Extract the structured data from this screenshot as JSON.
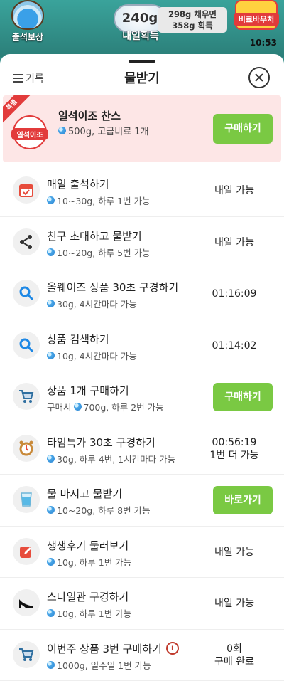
{
  "topbar": {
    "attend_label": "출석보상",
    "daily_amount": "240g",
    "daily_label": "내일획득",
    "fill_note_line1": "298g 채우면",
    "fill_note_line2": "358g 획득",
    "shop_label": "비료바우처",
    "time": "10:53"
  },
  "header": {
    "menu_label": "기록",
    "title": "물받기"
  },
  "featured": {
    "badge": "특별",
    "logo_text": "일석이조",
    "title": "일석이조 찬스",
    "reward": "500g, 고급비료 1개",
    "button": "구매하기"
  },
  "tasks": [
    {
      "title": "매일 출석하기",
      "prefix": "",
      "reward": "10~30g, 하루 1번 가능",
      "status": "내일 가능",
      "icon": "calendar-icon"
    },
    {
      "title": "친구 초대하고 물받기",
      "prefix": "",
      "reward": "10~20g, 하루 5번 가능",
      "status": "내일 가능",
      "icon": "share-icon"
    },
    {
      "title": "올웨이즈 상품 30초 구경하기",
      "prefix": "",
      "reward": "30g, 4시간마다 가능",
      "status": "01:16:09",
      "icon": "search-icon"
    },
    {
      "title": "상품 검색하기",
      "prefix": "",
      "reward": "10g, 4시간마다 가능",
      "status": "01:14:02",
      "icon": "search-icon"
    },
    {
      "title": "상품 1개 구매하기",
      "prefix": "구매시",
      "reward": "700g, 하루 2번 가능",
      "button": "구매하기",
      "icon": "cart-icon"
    },
    {
      "title": "타임특가 30초 구경하기",
      "prefix": "",
      "reward": "30g, 하루 4번, 1시간마다 가능",
      "status": "00:56:19",
      "status2": "1번 더 가능",
      "icon": "alarm-clock-icon"
    },
    {
      "title": "물 마시고 물받기",
      "prefix": "",
      "reward": "10~20g, 하루 8번 가능",
      "button": "바로가기",
      "icon": "water-glass-icon"
    },
    {
      "title": "생생후기 둘러보기",
      "prefix": "",
      "reward": "10g, 하루 1번 가능",
      "status": "내일 가능",
      "icon": "edit-icon"
    },
    {
      "title": "스타일관 구경하기",
      "prefix": "",
      "reward": "10g, 하루 1번 가능",
      "status": "내일 가능",
      "icon": "high-heel-icon"
    },
    {
      "title": "이번주 상품 3번 구매하기",
      "prefix": "",
      "reward": "1000g, 일주일 1번 가능",
      "status": "0회",
      "status2": "구매 완료",
      "icon": "cart-icon"
    }
  ],
  "colors": {
    "accent_green": "#7ac943",
    "featured_bg": "#fde6e6",
    "badge_red": "#e23b3b"
  }
}
